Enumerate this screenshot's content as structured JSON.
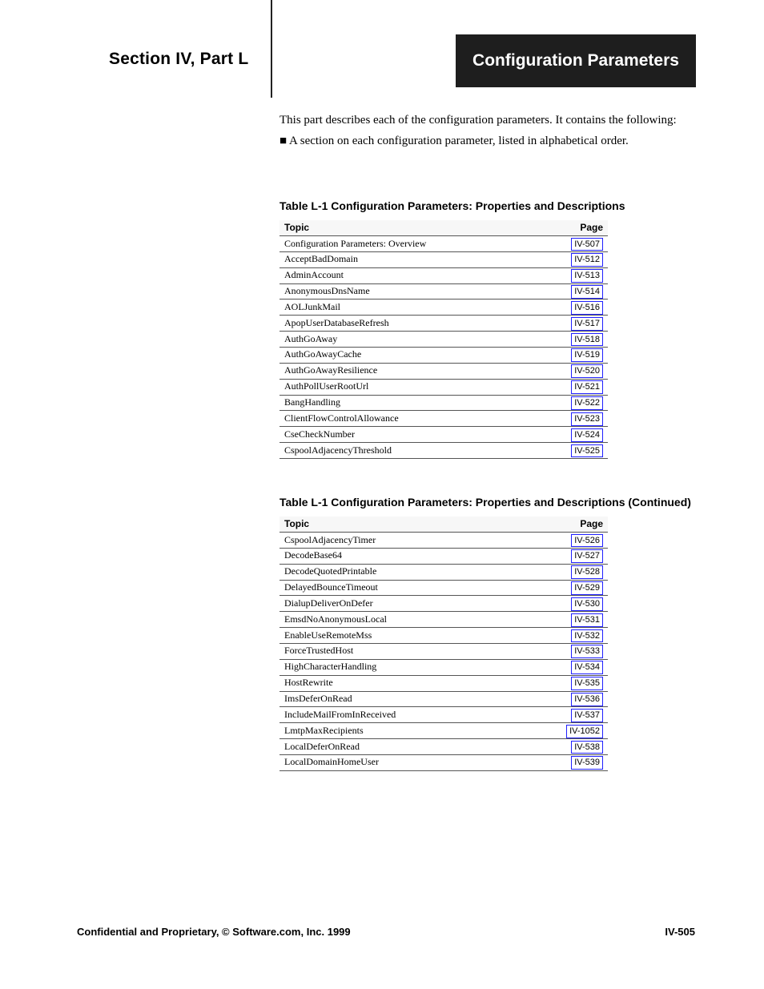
{
  "header": {
    "section_label": "Section IV, Part L",
    "black_box_text": "Configuration Parameters"
  },
  "intro": {
    "line1": "This part describes each of the configuration parameters. It contains the following:",
    "line2": "■ A section on each configuration parameter, listed in alphabetical order."
  },
  "tables": [
    {
      "title": "Table L-1 Configuration Parameters: Properties and Descriptions",
      "col_topic": "Topic",
      "col_page": "Page",
      "rows": [
        {
          "topic": "Configuration Parameters: Overview",
          "page": "IV-507"
        },
        {
          "topic": "AcceptBadDomain",
          "page": "IV-512"
        },
        {
          "topic": "AdminAccount",
          "page": "IV-513"
        },
        {
          "topic": "AnonymousDnsName",
          "page": "IV-514"
        },
        {
          "topic": "AOLJunkMail",
          "page": "IV-516"
        },
        {
          "topic": "ApopUserDatabaseRefresh",
          "page": "IV-517"
        },
        {
          "topic": "AuthGoAway",
          "page": "IV-518"
        },
        {
          "topic": "AuthGoAwayCache",
          "page": "IV-519"
        },
        {
          "topic": "AuthGoAwayResilience",
          "page": "IV-520"
        },
        {
          "topic": "AuthPollUserRootUrl",
          "page": "IV-521"
        },
        {
          "topic": "BangHandling",
          "page": "IV-522"
        },
        {
          "topic": "ClientFlowControlAllowance",
          "page": "IV-523"
        },
        {
          "topic": "CseCheckNumber",
          "page": "IV-524"
        },
        {
          "topic": "CspoolAdjacencyThreshold",
          "page": "IV-525"
        }
      ]
    },
    {
      "title": "Table L-1 Configuration Parameters: Properties and Descriptions (Continued)",
      "col_topic": "Topic",
      "col_page": "Page",
      "rows": [
        {
          "topic": "CspoolAdjacencyTimer",
          "page": "IV-526"
        },
        {
          "topic": "DecodeBase64",
          "page": "IV-527"
        },
        {
          "topic": "DecodeQuotedPrintable",
          "page": "IV-528"
        },
        {
          "topic": "DelayedBounceTimeout",
          "page": "IV-529"
        },
        {
          "topic": "DialupDeliverOnDefer",
          "page": "IV-530"
        },
        {
          "topic": "EmsdNoAnonymousLocal",
          "page": "IV-531"
        },
        {
          "topic": "EnableUseRemoteMss",
          "page": "IV-532"
        },
        {
          "topic": "ForceTrustedHost",
          "page": "IV-533"
        },
        {
          "topic": "HighCharacterHandling",
          "page": "IV-534"
        },
        {
          "topic": "HostRewrite",
          "page": "IV-535"
        },
        {
          "topic": "ImsDeferOnRead",
          "page": "IV-536"
        },
        {
          "topic": "IncludeMailFromInReceived",
          "page": "IV-537"
        },
        {
          "topic": "LmtpMaxRecipients",
          "page": "IV-1052"
        },
        {
          "topic": "LocalDeferOnRead",
          "page": "IV-538"
        },
        {
          "topic": "LocalDomainHomeUser",
          "page": "IV-539"
        }
      ]
    }
  ],
  "footer": {
    "left": "Confidential and Proprietary, © Software.com, Inc. 1999",
    "right": "IV-505"
  }
}
